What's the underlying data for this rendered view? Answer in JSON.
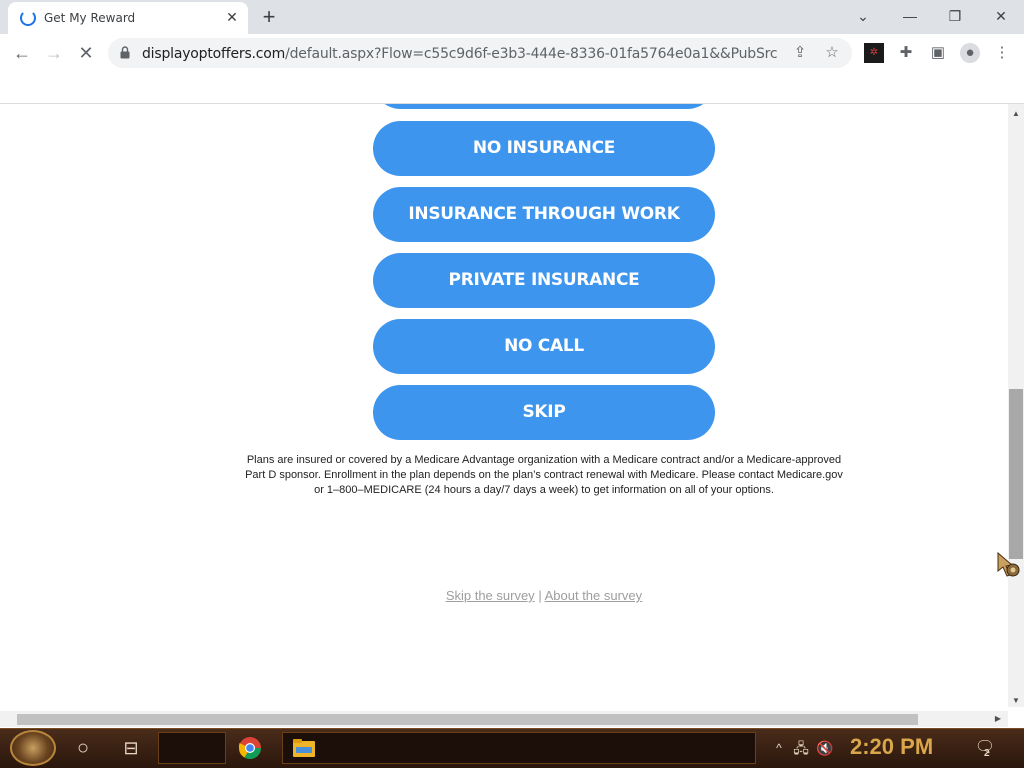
{
  "browser": {
    "tab_title": "Get My Reward",
    "tab_close": "✕",
    "new_tab": "+",
    "url_host": "displayoptoffers.com",
    "url_path": "/default.aspx?Flow=c55c9d6f-e3b3-444e-8336-01fa5764e0a1&&PubSrc=..."
  },
  "page": {
    "options": [
      "",
      "NO INSURANCE",
      "INSURANCE THROUGH WORK",
      "PRIVATE INSURANCE",
      "NO CALL",
      "SKIP"
    ],
    "disclaimer": "Plans are insured or covered by a Medicare Advantage organization with a Medicare contract and/or a Medicare-approved Part D sponsor. Enrollment in the plan depends on the plan’s contract renewal with Medicare. Please contact Medicare.gov or 1–800–MEDICARE (24 hours a day/7 days a week) to get information on all of your options.",
    "skip_link": "Skip the survey",
    "link_separator": "|",
    "about_link": "About the survey"
  },
  "taskbar": {
    "clock": "2:20 PM",
    "notification_count": "2"
  },
  "colors": {
    "button": "#3d95ee",
    "accent": "#1a73e8",
    "clock": "#d9a64a"
  }
}
